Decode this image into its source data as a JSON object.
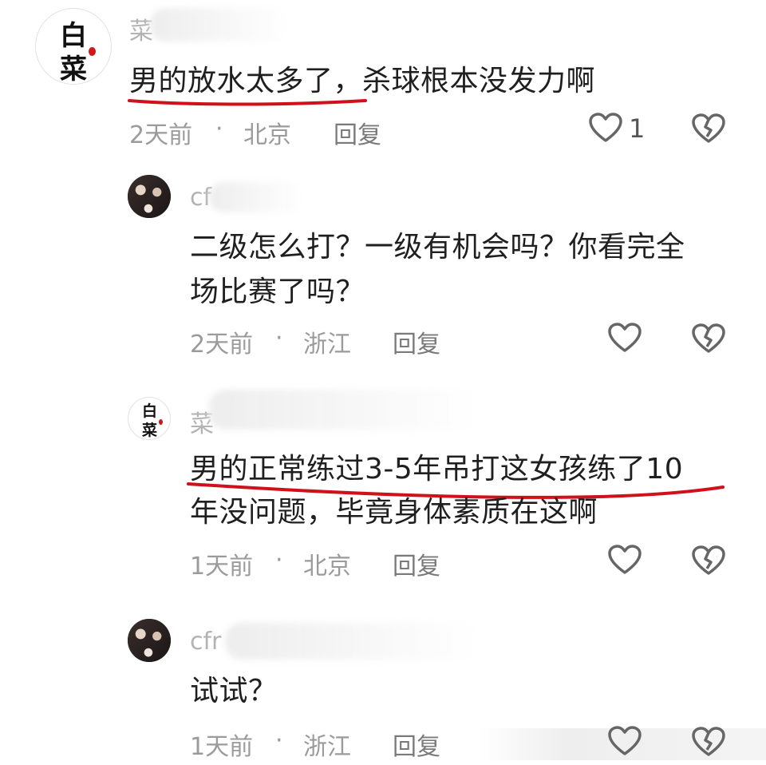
{
  "comments": [
    {
      "username": "菜",
      "text_line1": "男的放水太多了，杀球根本没发力啊",
      "time": "2天前",
      "sep": "·",
      "location": "北京",
      "reply": "回复",
      "likes": "1",
      "avatar_chars": [
        "白",
        "菜"
      ]
    },
    {
      "username": "cf",
      "text_line1": "二级怎么打？一级有机会吗？你看完全",
      "text_line2": "场比赛了吗？",
      "time": "2天前",
      "sep": "·",
      "location": "浙江",
      "reply": "回复"
    },
    {
      "username": "菜",
      "text_line1": "男的正常练过3-5年吊打这女孩练了10",
      "text_line2": "年没问题，毕竟身体素质在这啊",
      "time": "1天前",
      "sep": "·",
      "location": "北京",
      "reply": "回复",
      "avatar_chars": [
        "白",
        "菜"
      ]
    },
    {
      "username": "cfr",
      "text_line1": "试试？",
      "time": "1天前",
      "sep": "·",
      "location": "浙江",
      "reply": "回复"
    }
  ],
  "colors": {
    "text": "#1f1f1f",
    "meta": "#9b9b9b",
    "underline": "#d0101a",
    "seal": "#d01818"
  }
}
